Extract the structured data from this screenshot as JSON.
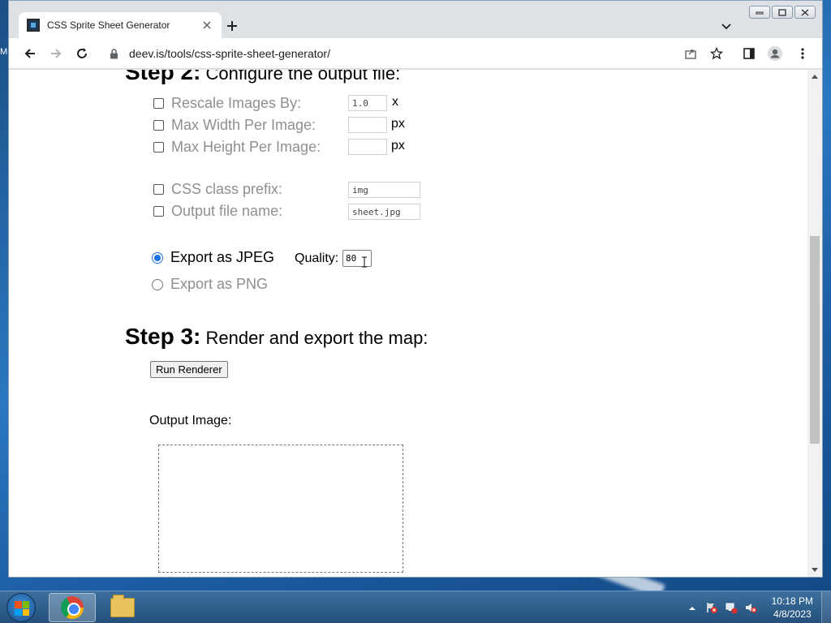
{
  "browser": {
    "tab_title": "CSS Sprite Sheet Generator",
    "url": "deev.is/tools/css-sprite-sheet-generator/"
  },
  "desktop": {
    "left_label": "M"
  },
  "page": {
    "step2_bold": "Step 2:",
    "step2_text": " Configure the output file:",
    "options": [
      {
        "label": "Rescale Images By:",
        "value": "1.0",
        "unit": "x",
        "checked": false
      },
      {
        "label": "Max Width Per Image:",
        "value": "",
        "unit": "px",
        "checked": false
      },
      {
        "label": "Max Height Per Image:",
        "value": "",
        "unit": "px",
        "checked": false
      },
      {
        "label": "CSS class prefix:",
        "value": "img",
        "checked": false
      },
      {
        "label": "Output file name:",
        "value": "sheet.jpg",
        "checked": false
      }
    ],
    "export_jpeg": "Export as JPEG",
    "export_png": "Export as PNG",
    "export_selected": "jpeg",
    "quality_label": "Quality:",
    "quality_value": "80",
    "step3_bold": "Step 3:",
    "step3_text": " Render and export the map:",
    "run_button": "Run Renderer",
    "output_label": "Output Image:"
  },
  "taskbar": {
    "time": "10:18 PM",
    "date": "4/8/2023"
  }
}
